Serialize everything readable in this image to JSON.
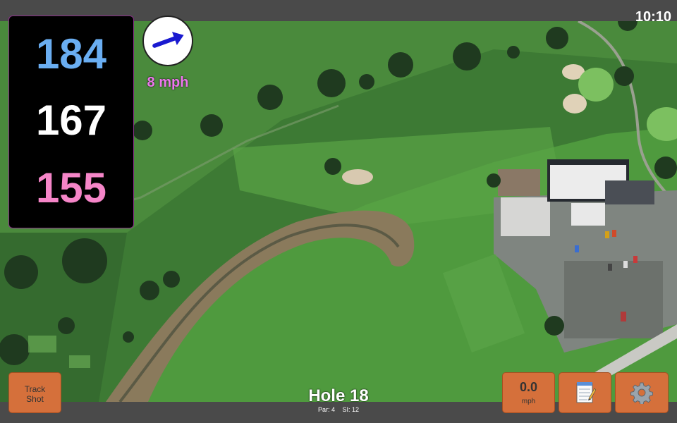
{
  "status": {
    "time": "10:10"
  },
  "distances": {
    "back": "184",
    "middle": "167",
    "front": "155"
  },
  "wind": {
    "speed_label": "8 mph",
    "direction_deg": 70,
    "icon": "arrow-icon"
  },
  "hole": {
    "title": "Hole 18",
    "par_label": "Par: 4",
    "si_label": "SI: 12"
  },
  "buttons": {
    "track_shot_line1": "Track",
    "track_shot_line2": "Shot",
    "speed_value": "0.0",
    "speed_unit": "mph",
    "notes_icon": "notepad-icon",
    "settings_icon": "gear-icon"
  },
  "colors": {
    "back_distance": "#6aaef2",
    "middle_distance": "#ffffff",
    "front_distance": "#f585c8",
    "wind_label": "#ee77ee",
    "button": "#d5703b"
  }
}
